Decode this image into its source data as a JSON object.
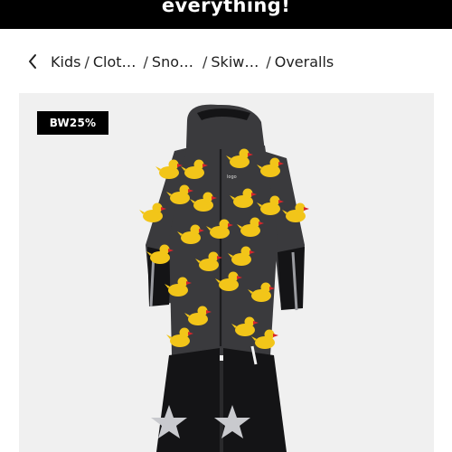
{
  "promo": {
    "text": "everything!"
  },
  "breadcrumb": {
    "items": [
      "Kids",
      "Clot…",
      "Sno…",
      "Skiw…",
      "Overalls"
    ],
    "separator": "/"
  },
  "product": {
    "badge": "BW25%",
    "colors": {
      "suit": "#3a3a3d",
      "duck": "#f2c519",
      "beak": "#d8252a",
      "panel": "#141416",
      "star": "#c9cace"
    }
  }
}
